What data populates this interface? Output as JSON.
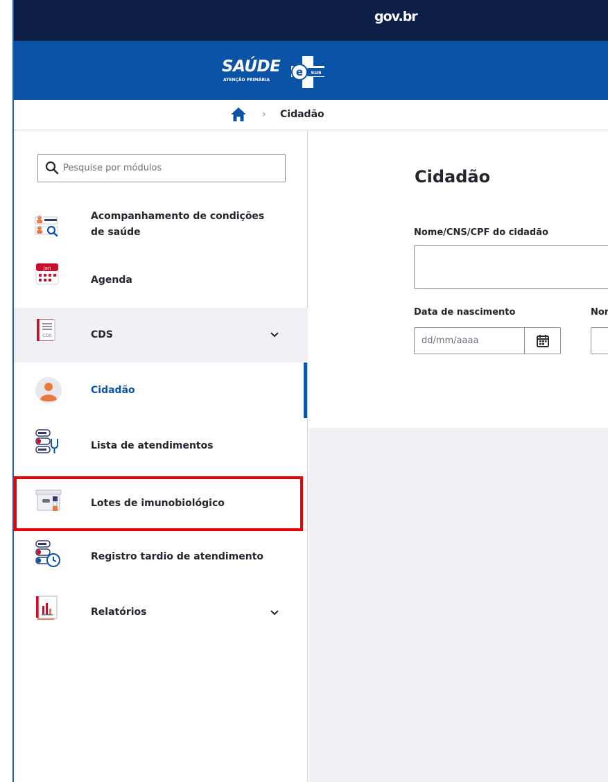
{
  "gov_bar": {
    "logo_text": "gov.br"
  },
  "brand": {
    "title": "SAÚDE",
    "subtitle": "ATENÇÃO PRIMÁRIA",
    "badge_text": "sus",
    "badge_letter": "e"
  },
  "breadcrumb": {
    "home_icon": "home-icon",
    "separator": "›",
    "current": "Cidadão"
  },
  "sidebar": {
    "search_placeholder": "Pesquise por módulos",
    "items": [
      {
        "label_line1": "Acompanhamento de condições",
        "label_line2": "de saúde",
        "icon": "health-monitoring-icon"
      },
      {
        "label": "Agenda",
        "icon": "calendar-icon",
        "calendar_month": "Jan"
      },
      {
        "label": "CDS",
        "icon": "cds-icon",
        "icon_text": "CDS",
        "expandable": true
      },
      {
        "label": "Cidadão",
        "icon": "citizen-avatar-icon",
        "active": true
      },
      {
        "label": "Lista de atendimentos",
        "icon": "attendance-list-icon"
      },
      {
        "label": "Lotes de imunobiológico",
        "icon": "immunobiological-lots-icon",
        "highlighted": true
      },
      {
        "label": "Registro tardio de atendimento",
        "icon": "late-registration-icon"
      },
      {
        "label": "Relatórios",
        "icon": "reports-icon",
        "expandable": true
      }
    ]
  },
  "main": {
    "title": "Cidadão",
    "name_label": "Nome/CNS/CPF do cidadão",
    "name_value": "",
    "birth_label": "Data de nascimento",
    "birth_placeholder": "dd/mm/aaaa",
    "truncated_label": "Nor"
  },
  "colors": {
    "gov_bar": "#0d1e47",
    "brand_bar": "#0b53a6",
    "accent": "#0b53a6",
    "highlight_border": "#ee0000",
    "panel_bg": "#f0f0f5"
  }
}
